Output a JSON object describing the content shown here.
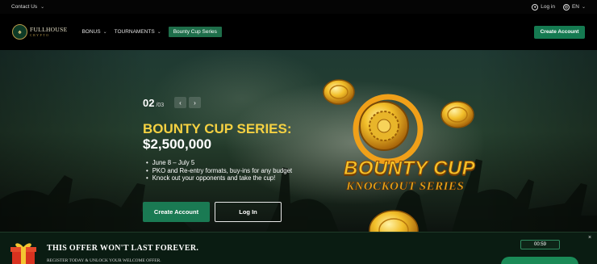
{
  "topbar": {
    "contact": "Contact Us",
    "login": "Log in",
    "lang": "EN"
  },
  "nav": {
    "brand_line1": "FULLHOUSE",
    "brand_line2": "CRYPTO",
    "menu": [
      {
        "label": "BONUS",
        "dropdown": true
      },
      {
        "label": "TOURNAMENTS",
        "dropdown": true
      }
    ],
    "tag": "Bounty Cup Series",
    "cta": "Create Account"
  },
  "hero": {
    "slide_current": "02",
    "slide_total": "/03",
    "title_line1": "BOUNTY CUP SERIES:",
    "title_line2": "$2,500,000",
    "bullets": [
      "June 8 – July 5",
      "PKO and Re-entry formats, buy-ins for any budget",
      "Knock out your opponents and take the cup!"
    ],
    "btn_create": "Create Account",
    "btn_login": "Log In",
    "art_line1": "BOUNTY CUP",
    "art_line2": "KNOCKOUT SERIES"
  },
  "offer": {
    "title": "THIS OFFER WON'T LAST FOREVER.",
    "subtitle": "REGISTER TODAY & UNLOCK YOUR WELCOME OFFER.",
    "timer": "00:59"
  },
  "colors": {
    "accent_green": "#157a51",
    "title_gold": "#f5d142",
    "offer_bg": "#0a1c12"
  }
}
